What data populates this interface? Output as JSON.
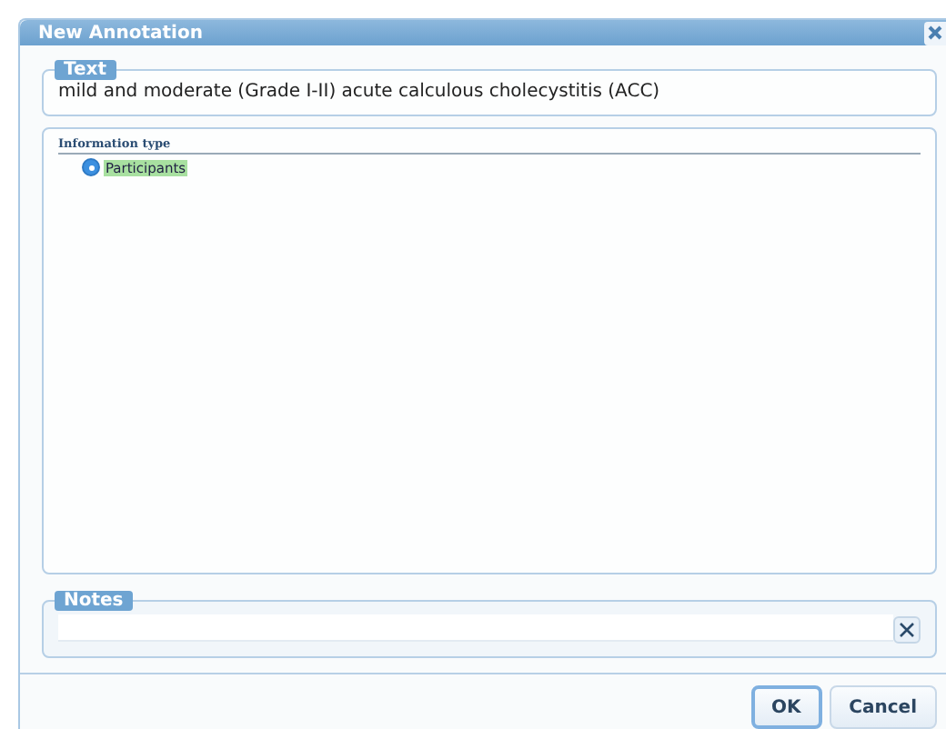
{
  "window": {
    "title": "New Annotation"
  },
  "text_section": {
    "legend": "Text",
    "value": "mild and moderate (Grade I-II) acute calculous cholecystitis (ACC)"
  },
  "information_type": {
    "heading": "Information type",
    "options": [
      {
        "label": "Participants",
        "selected": true,
        "color": "#a8e0a0"
      }
    ]
  },
  "notes": {
    "legend": "Notes"
  },
  "buttons": [
    {
      "label": "OK",
      "kind": "primary"
    },
    {
      "label": "Cancel",
      "kind": "secondary"
    }
  ]
}
